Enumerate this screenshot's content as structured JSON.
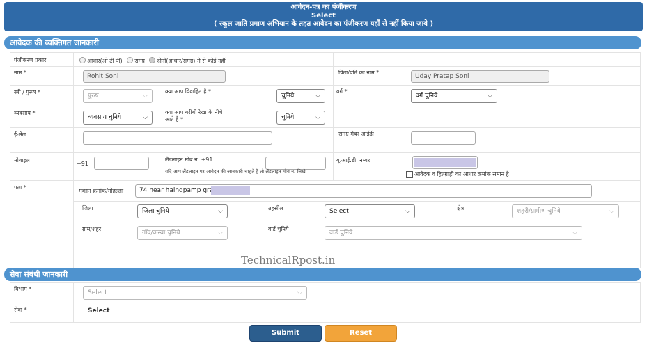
{
  "header": {
    "line1": "आवेदन-पत्र का पंजीकरण",
    "line2": "Select",
    "line3": "( स्कूल जाति प्रमाण अभियान के तहत आवेदन का पंजीकरण यहाँ से नहीं किया जाये )"
  },
  "personal_section": {
    "title": "आवेदक की व्यक्तिगत जानकारी",
    "reg_type_label": "पंजीकरण प्रकार",
    "reg_options": [
      "आधार(ओ टी पी)",
      "समग्र",
      "दोनों(आधार/समग्र) में से कोई नहीं"
    ],
    "name_label": "नाम *",
    "name_value": "Rohit Soni",
    "father_label": "पिता/पति का नाम *",
    "father_value": "Uday Pratap Soni",
    "gender_label": "स्त्री / पुरुष *",
    "gender_value": "पुरुष",
    "married_label": "क्या आप विवाहित है *",
    "married_value": "चुनिये",
    "category_label": "वर्ग *",
    "category_value": "वर्ग चुनिये",
    "occupation_label": "व्यवसाय *",
    "occupation_value": "व्यवसाय चुनिये",
    "bpl_label_1": "क्या आप गरीबी रेखा के नीचे",
    "bpl_label_2": "आते है *",
    "bpl_value": "चुनिये",
    "email_label": "ई-मेल",
    "samagra_label": "समग्र मेंबर आईडी",
    "mobile_label": "मोबाइल",
    "mobile_prefix": "+91",
    "landline_label": "लैंडलाइन मोब.न. +91",
    "landline_note": "यदि आप लैंडलाइन पर आवेदन की जानकारी चाहते है तो लैंडलाइन मोब न. लिखे",
    "uid_label": "यू.आई.डी. नम्बर",
    "uid_check_label": "आवेदक व हितग्राही का आधार क्रमांक समान है",
    "address_label": "पता *",
    "house_label": "मकान क्रमांक/मोहल्ला",
    "house_value": "74  near haindpamp gran",
    "district_label": "जिला",
    "district_value": "जिला चुनिये",
    "tehsil_label": "तहसील",
    "tehsil_value": "Select",
    "area_label": "क्षेत्र",
    "area_value": "शहरी/ग्रामीण चुनिये",
    "village_label": "ग्राम/शहर",
    "village_value": "गाँव/कस्बा चुनिये",
    "ward_label": "वार्ड चुनिये",
    "ward_value": "वार्ड चुनिये"
  },
  "service_section": {
    "title": "सेवा संबंधी जानकारी",
    "dept_label": "विभाग *",
    "dept_value": "Select",
    "service_label": "सेवा *",
    "service_value": "Select"
  },
  "watermark": "TechnicalRpost.in",
  "buttons": {
    "submit": "Submit",
    "reset": "Reset"
  },
  "colors": {
    "header_blue": "#2f6aa8",
    "section_blue": "#4f93cf",
    "submit": "#2c5e8e",
    "reset": "#f2a43a"
  },
  "icons": {
    "dropdown": "chevron-down-icon"
  }
}
